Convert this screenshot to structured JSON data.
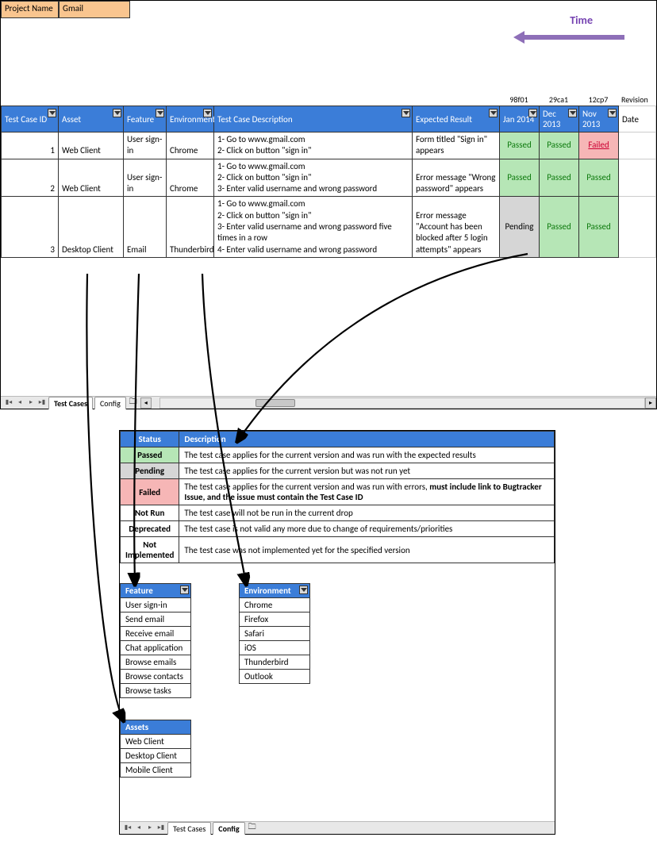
{
  "project": {
    "label": "Project Name",
    "value": "Gmail"
  },
  "time_label": "Time",
  "revisions": [
    {
      "code": "98f01",
      "month": "Jan 2014"
    },
    {
      "code": "29ca1",
      "month": "Dec 2013"
    },
    {
      "code": "12cp7",
      "month": "Nov 2013"
    }
  ],
  "revision_label": "Revision",
  "date_label": "Date",
  "headers": [
    "Test Case ID",
    "Asset",
    "Feature",
    "Environment",
    "Test Case Description",
    "Expected Result",
    "Jan 2014",
    "Dec 2013",
    "Nov 2013"
  ],
  "rows": [
    {
      "id": "1",
      "asset": "Web Client",
      "feature": "User sign-in",
      "environment": "Chrome",
      "description": "1- Go to www.gmail.com\n2- Click on button \"sign in\"",
      "expected": "Form titled \"Sign in\" appears",
      "results": [
        {
          "status": "Passed",
          "class": "passed"
        },
        {
          "status": "Passed",
          "class": "passed"
        },
        {
          "status": "Failed",
          "class": "failed"
        }
      ]
    },
    {
      "id": "2",
      "asset": "Web Client",
      "feature": "User sign-in",
      "environment": "Chrome",
      "description": "1- Go to www.gmail.com\n2- Click on button \"sign in\"\n3- Enter valid username and wrong password",
      "expected": "Error message \"Wrong password\" appears",
      "results": [
        {
          "status": "Passed",
          "class": "passed"
        },
        {
          "status": "Passed",
          "class": "passed"
        },
        {
          "status": "Passed",
          "class": "passed"
        }
      ]
    },
    {
      "id": "3",
      "asset": "Desktop Client",
      "feature": "Email",
      "environment": "Thunderbird",
      "description": "1- Go to www.gmail.com\n2- Click on button \"sign in\"\n3- Enter valid username and wrong password five times in a row\n4- Enter valid username and wrong password",
      "expected": "Error message \"Account has been blocked after 5 login attempts\" appears",
      "results": [
        {
          "status": "Pending",
          "class": "pending-cell"
        },
        {
          "status": "Passed",
          "class": "passed"
        },
        {
          "status": "Passed",
          "class": "passed"
        }
      ]
    }
  ],
  "tabs_top": [
    "Test Cases",
    "Config"
  ],
  "tabs_bottom": [
    "Test Cases",
    "Config"
  ],
  "status_headers": [
    "Status",
    "Description"
  ],
  "status_rows": [
    {
      "status": "Passed",
      "class": "st-passed",
      "desc": "The test case applies for the current version and was run with the expected results"
    },
    {
      "status": "Pending",
      "class": "st-pending",
      "desc": "The test case applies for the current version but was not run yet"
    },
    {
      "status": "Failed",
      "class": "st-failed",
      "desc_html": "The test case applies for the current version and was run with errors, <b>must include link to Bugtracker Issue, and the issue must contain the Test Case ID</b>"
    },
    {
      "status": "Not Run",
      "class": "",
      "desc": "The test case will not be run in the current drop"
    },
    {
      "status": "Deprecated",
      "class": "",
      "desc": "The test case is not valid any more due to change of requirements/priorities"
    },
    {
      "status": "Not Implemented",
      "class": "",
      "desc": "The test case was not implemented yet for the specified version"
    }
  ],
  "feature_header": "Feature",
  "feature_items": [
    "User sign-in",
    "Send email",
    "Receive email",
    "Chat application",
    "Browse emails",
    "Browse contacts",
    "Browse tasks"
  ],
  "environment_header": "Environment",
  "environment_items": [
    "Chrome",
    "Firefox",
    "Safari",
    "iOS",
    "Thunderbird",
    "Outlook"
  ],
  "assets_header": "Assets",
  "assets_items": [
    "Web Client",
    "Desktop Client",
    "Mobile Client"
  ]
}
